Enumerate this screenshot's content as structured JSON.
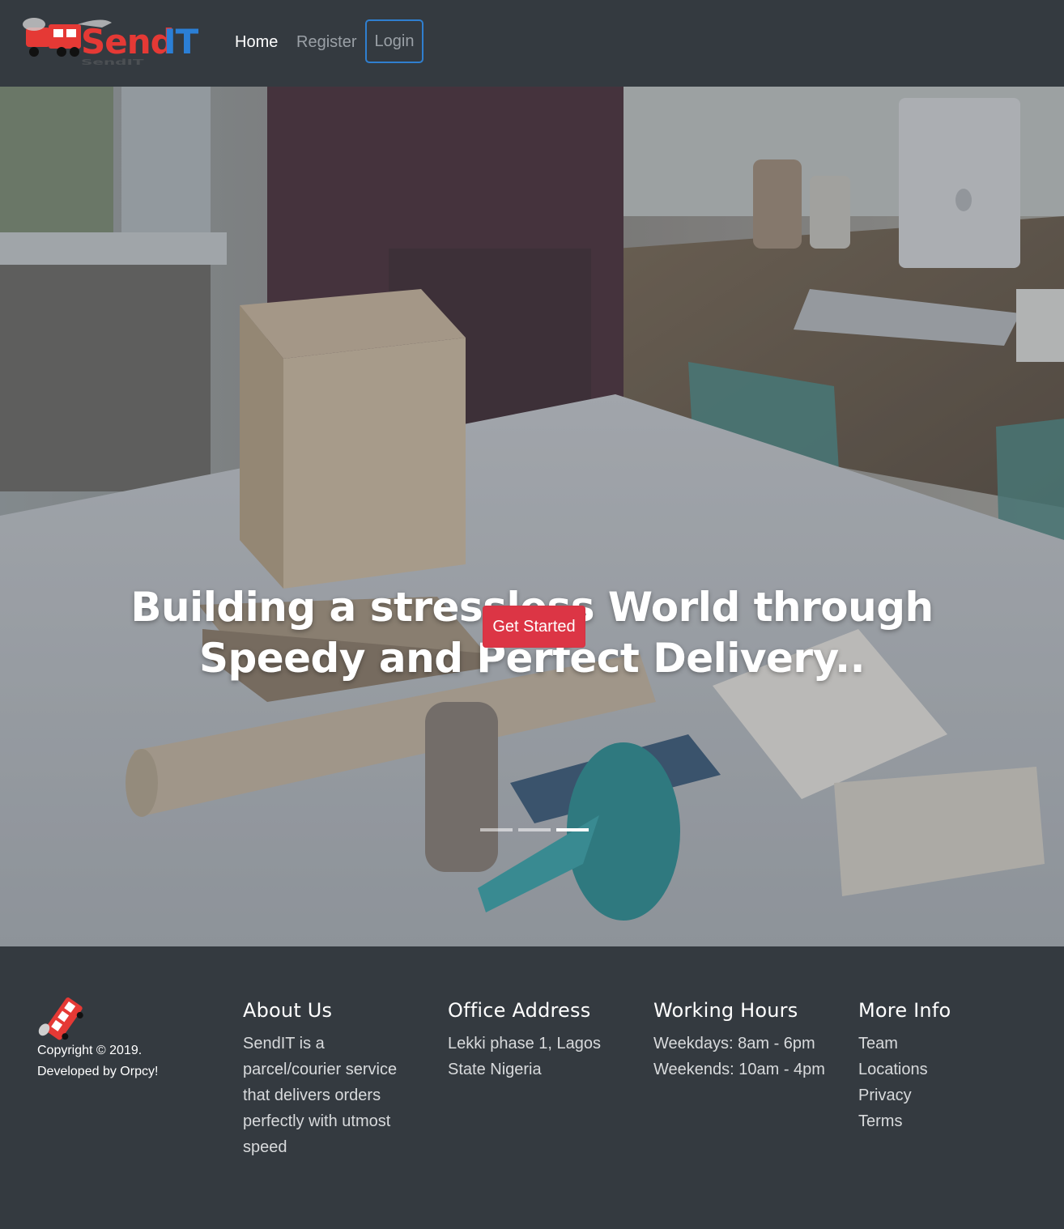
{
  "navbar": {
    "brand": "SendIT",
    "links": {
      "home": "Home",
      "register": "Register",
      "login": "Login"
    }
  },
  "hero": {
    "title_line1": "Building a stressless World through",
    "title_line2": "Speedy and Perfect Delivery..",
    "cta_label": "Get Started",
    "indicators": 3,
    "active_indicator": 3
  },
  "footer": {
    "copyright_line1": "Copyright © 2019.",
    "copyright_line2": "Developed by Orpcy!",
    "about": {
      "heading": "About Us",
      "text": "SendIT is a parcel/courier service that delivers orders perfectly with utmost speed"
    },
    "office": {
      "heading": "Office Address",
      "text": "Lekki phase 1, Lagos State Nigeria"
    },
    "hours": {
      "heading": "Working Hours",
      "weekdays": "Weekdays: 8am - 6pm",
      "weekends": "Weekends: 10am - 4pm"
    },
    "more": {
      "heading": "More Info",
      "items": [
        "Team",
        "Locations",
        "Privacy",
        "Terms"
      ]
    }
  },
  "colors": {
    "nav_bg": "#343a40",
    "accent_red": "#dc3545",
    "brand_blue": "#2f7fd0"
  }
}
